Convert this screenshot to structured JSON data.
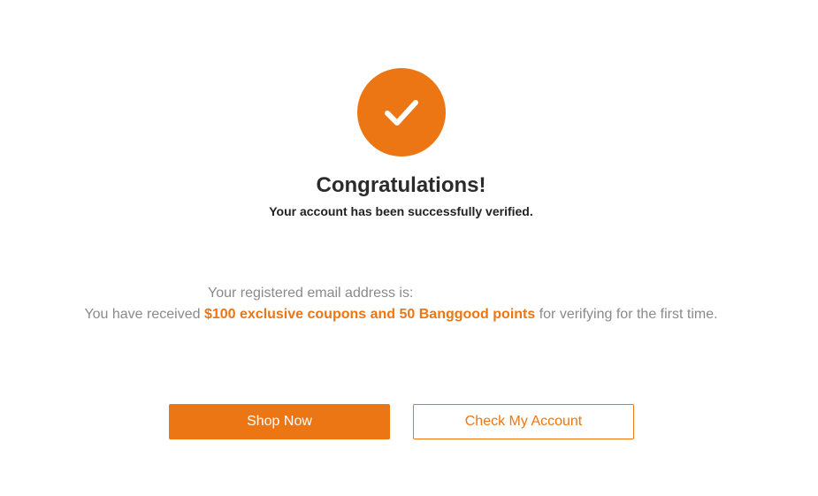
{
  "header": {
    "title": "Congratulations!",
    "subtitle": "Your account has been successfully verified."
  },
  "icons": {
    "success": "checkmark-icon"
  },
  "message": {
    "email_label": "Your registered email address is:",
    "reward_prefix": "You have received ",
    "reward_highlight": "$100 exclusive coupons and 50 Banggood points",
    "reward_suffix": " for verifying for the first time."
  },
  "actions": {
    "shop_now_label": "Shop Now",
    "check_account_label": "Check My Account"
  },
  "colors": {
    "accent": "#ec7613",
    "title_text": "#2b2b2b",
    "body_text": "#8a8a8a"
  }
}
